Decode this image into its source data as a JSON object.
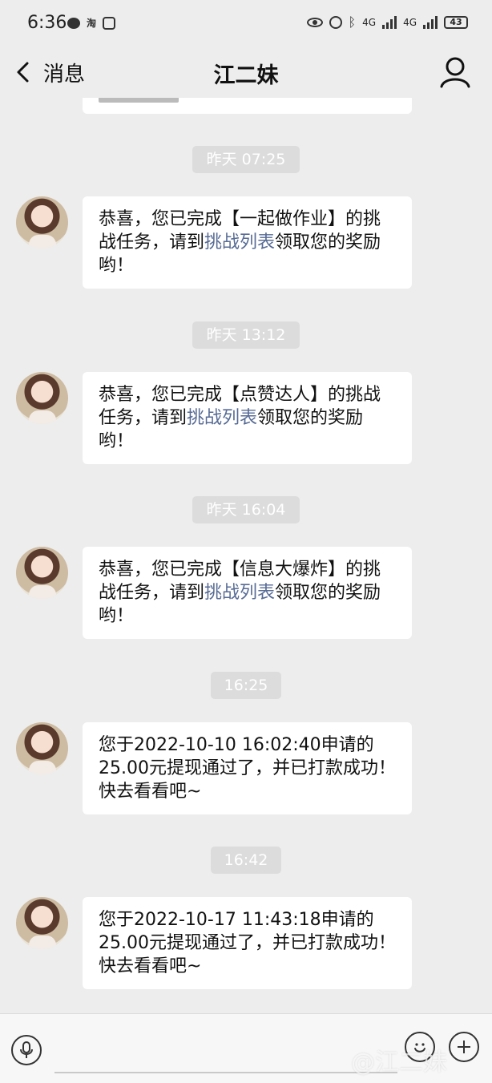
{
  "status_bar": {
    "time": "6:36",
    "tao_icon": "淘",
    "battery": "43",
    "network_a": "4G",
    "network_b": "4G"
  },
  "nav": {
    "back_label": "消息",
    "title": "江二妹"
  },
  "messages": [
    {
      "timestamp": "昨天 07:25",
      "pre": "恭喜，您已完成【一起做作业】的挑战任务，请到",
      "link": "挑战列表",
      "post": "领取您的奖励哟！"
    },
    {
      "timestamp": "昨天 13:12",
      "pre": "恭喜，您已完成【点赞达人】的挑战任务，请到",
      "link": "挑战列表",
      "post": "领取您的奖励哟！"
    },
    {
      "timestamp": "昨天 16:04",
      "pre": "恭喜，您已完成【信息大爆炸】的挑战任务，请到",
      "link": "挑战列表",
      "post": "领取您的奖励哟！"
    },
    {
      "timestamp": "16:25",
      "text": "您于2022-10-10 16:02:40申请的25.00元提现通过了，并已打款成功！快去看看吧~"
    },
    {
      "timestamp": "16:42",
      "text": "您于2022-10-17 11:43:18申请的25.00元提现通过了，并已打款成功！快去看看吧~"
    }
  ],
  "input": {
    "placeholder": ""
  },
  "watermark": "@江二妹"
}
